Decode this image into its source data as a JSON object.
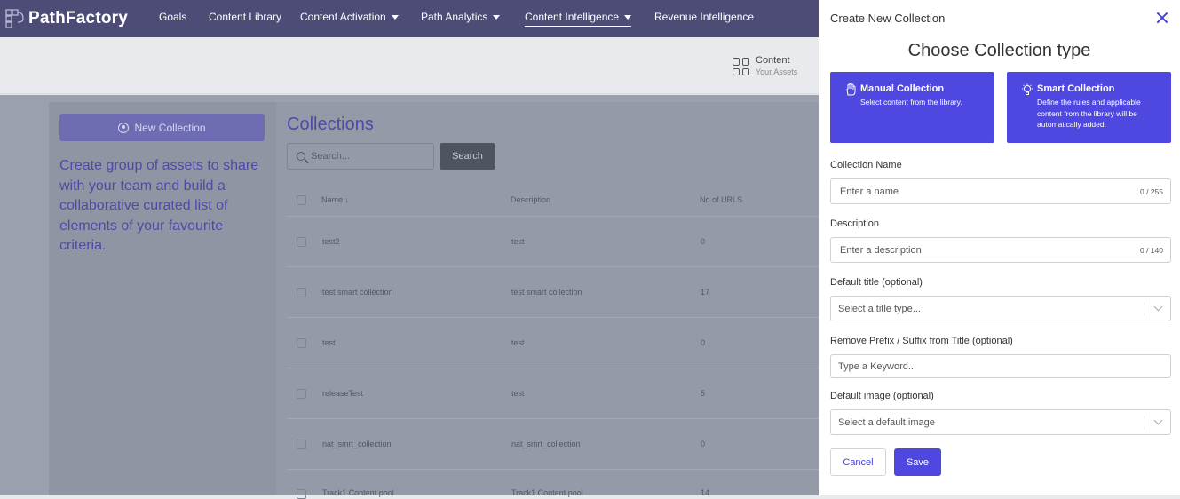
{
  "nav": {
    "logo": "PathFactory",
    "items": [
      {
        "label": "Goals"
      },
      {
        "label": "Content Library"
      },
      {
        "label": "Content Activation"
      },
      {
        "label": "Path Analytics"
      },
      {
        "label": "Content Intelligence"
      },
      {
        "label": "Revenue Intelligence"
      }
    ]
  },
  "header": {
    "tile_title": "Content",
    "tile_sub": "Your Assets"
  },
  "left": {
    "new_collection_label": "New Collection",
    "description": "Create group of assets to share with your team and build a collaborative curated list of elements of your favourite criteria."
  },
  "main": {
    "title": "Collections",
    "search_placeholder": "Search...",
    "search_button": "Search",
    "columns": [
      "Name ↓",
      "Description",
      "No of URLS"
    ],
    "rows": [
      {
        "name": "test2",
        "description": "test",
        "urls": "0"
      },
      {
        "name": "test smart collection",
        "description": "test smart collection",
        "urls": "17"
      },
      {
        "name": "test",
        "description": "test",
        "urls": "0"
      },
      {
        "name": "releaseTest",
        "description": "test",
        "urls": "5"
      },
      {
        "name": "nat_smrt_collection",
        "description": "nat_smrt_collection",
        "urls": "0"
      },
      {
        "name": "Track1 Content pool",
        "description": "Track1 Content pool",
        "urls": "14"
      }
    ]
  },
  "drawer": {
    "title": "Create New Collection",
    "heading": "Choose Collection type",
    "manual": {
      "title": "Manual Collection",
      "desc": "Select content from the library."
    },
    "smart": {
      "title": "Smart Collection",
      "desc": "Define the rules and applicable content from the library will be automatically added."
    },
    "fields": {
      "name_label": "Collection Name",
      "name_placeholder": "Enter a name",
      "name_count": "0 / 255",
      "desc_label": "Description",
      "desc_placeholder": "Enter a description",
      "desc_count": "0 / 140",
      "title_label": "Default title (optional)",
      "title_placeholder": "Select a title type...",
      "prefix_label": "Remove Prefix / Suffix from Title (optional)",
      "prefix_placeholder": "Type a Keyword...",
      "image_label": "Default image (optional)",
      "image_placeholder": "Select a default image"
    },
    "cancel": "Cancel",
    "save": "Save"
  },
  "colors": {
    "accent": "#4e48e0",
    "nav_bg": "#4d4c77"
  }
}
